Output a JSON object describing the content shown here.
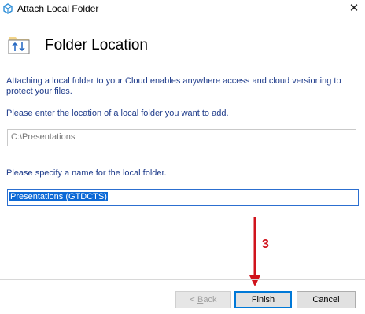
{
  "window": {
    "title": "Attach Local Folder",
    "close_glyph": "✕"
  },
  "header": {
    "title": "Folder Location",
    "icon": "folder-sync-icon"
  },
  "body": {
    "description": "Attaching a local folder to your Cloud enables anywhere access and cloud versioning to protect your files.",
    "location_label": "Please enter the location of a local folder you want to add.",
    "location_value": "C:\\Presentations",
    "name_label": "Please specify a name for the local folder.",
    "name_value": "Presentations (GTDCTS)"
  },
  "annotation": {
    "step_number": "3",
    "color": "#d0131c"
  },
  "buttons": {
    "back_prefix": "< ",
    "back_mnemonic": "B",
    "back_rest": "ack",
    "finish_label": "Finish",
    "cancel_label": "Cancel"
  },
  "colors": {
    "label_text": "#1e3b8a",
    "selection": "#0c69d6",
    "focus_border": "#0078d7"
  }
}
